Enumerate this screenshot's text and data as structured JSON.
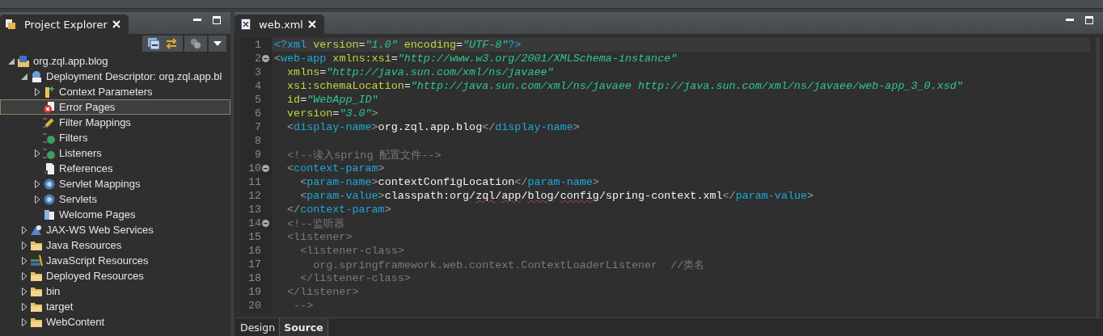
{
  "explorer": {
    "title": "Project Explorer",
    "tree": [
      {
        "label": "org.zql.app.blog",
        "kind": "project",
        "expanded": true,
        "selected": false,
        "children": [
          {
            "label": "Deployment Descriptor: org.zql.app.bl",
            "kind": "descriptor",
            "expanded": true,
            "selected": false,
            "children": [
              {
                "label": "Context Parameters",
                "kind": "params",
                "expanded": false,
                "selected": false
              },
              {
                "label": "Error Pages",
                "kind": "error",
                "selected": true
              },
              {
                "label": "Filter Mappings",
                "kind": "mapping",
                "selected": false
              },
              {
                "label": "Filters",
                "kind": "class",
                "selected": false
              },
              {
                "label": "Listeners",
                "kind": "listener",
                "expanded": false,
                "selected": false
              },
              {
                "label": "References",
                "kind": "reference",
                "selected": false
              },
              {
                "label": "Servlet Mappings",
                "kind": "servlet",
                "expanded": false,
                "selected": false
              },
              {
                "label": "Servlets",
                "kind": "servlet",
                "expanded": false,
                "selected": false
              },
              {
                "label": "Welcome Pages",
                "kind": "welcome",
                "selected": false
              }
            ]
          },
          {
            "label": "JAX-WS Web Services",
            "kind": "service",
            "expanded": false,
            "selected": false
          },
          {
            "label": "Java Resources",
            "kind": "java",
            "expanded": false,
            "selected": false
          },
          {
            "label": "JavaScript Resources",
            "kind": "script",
            "expanded": false,
            "selected": false
          },
          {
            "label": "Deployed Resources",
            "kind": "deployed",
            "expanded": false,
            "selected": false
          },
          {
            "label": "bin",
            "kind": "folder",
            "expanded": false,
            "selected": false
          },
          {
            "label": "target",
            "kind": "folder",
            "expanded": false,
            "selected": false
          },
          {
            "label": "WebContent",
            "kind": "folder",
            "expanded": false,
            "selected": false
          }
        ]
      }
    ]
  },
  "editor": {
    "tab": "web.xml",
    "lines": [
      {
        "n": "1",
        "fold": false,
        "current": true,
        "tokens": [
          {
            "kind": "tag",
            "text": "<?xml "
          },
          {
            "kind": "attr",
            "text": "version"
          },
          {
            "kind": "plain",
            "text": "="
          },
          {
            "kind": "value",
            "text": "\"1.0\" "
          },
          {
            "kind": "attr",
            "text": "encoding"
          },
          {
            "kind": "plain",
            "text": "="
          },
          {
            "kind": "value",
            "text": "\"UTF-8\""
          },
          {
            "kind": "tag",
            "text": "?>"
          }
        ]
      },
      {
        "n": "2",
        "fold": true,
        "current": false,
        "tokens": [
          {
            "kind": "punct",
            "text": "<"
          },
          {
            "kind": "tag",
            "text": "web-app "
          },
          {
            "kind": "attr",
            "text": "xmlns:xsi"
          },
          {
            "kind": "plain",
            "text": "="
          },
          {
            "kind": "value",
            "text": "\"http://www.w3.org/2001/XMLSchema-instance\""
          }
        ]
      },
      {
        "n": "3",
        "fold": false,
        "current": false,
        "tokens": [
          {
            "kind": "attr",
            "text": "  xmlns"
          },
          {
            "kind": "plain",
            "text": "="
          },
          {
            "kind": "value",
            "text": "\"http://java.sun.com/xml/ns/javaee\""
          }
        ]
      },
      {
        "n": "4",
        "fold": false,
        "current": false,
        "tokens": [
          {
            "kind": "attr",
            "text": "  xsi:schemaLocation"
          },
          {
            "kind": "plain",
            "text": "="
          },
          {
            "kind": "value",
            "text": "\"http://java.sun.com/xml/ns/javaee http://java.sun.com/xml/ns/javaee/web-app_3_0.xsd\""
          }
        ]
      },
      {
        "n": "5",
        "fold": false,
        "current": false,
        "tokens": [
          {
            "kind": "attr",
            "text": "  id"
          },
          {
            "kind": "plain",
            "text": "="
          },
          {
            "kind": "value",
            "text": "\"WebApp_ID\""
          }
        ]
      },
      {
        "n": "6",
        "fold": false,
        "current": false,
        "tokens": [
          {
            "kind": "attr",
            "text": "  version"
          },
          {
            "kind": "plain",
            "text": "="
          },
          {
            "kind": "value",
            "text": "\"3.0\""
          },
          {
            "kind": "punct",
            "text": ">"
          }
        ]
      },
      {
        "n": "7",
        "fold": false,
        "current": false,
        "tokens": [
          {
            "kind": "punct",
            "text": "  <"
          },
          {
            "kind": "tag",
            "text": "display-name"
          },
          {
            "kind": "punct",
            "text": ">"
          },
          {
            "kind": "plain",
            "text": "org.zql.app.blog"
          },
          {
            "kind": "punct",
            "text": "</"
          },
          {
            "kind": "tag",
            "text": "display-name"
          },
          {
            "kind": "punct",
            "text": ">"
          }
        ]
      },
      {
        "n": "8",
        "fold": false,
        "current": false
      },
      {
        "n": "9",
        "fold": false,
        "current": false,
        "tokens": [
          {
            "kind": "comment",
            "text": "  <!--读入spring 配置文件-->"
          }
        ]
      },
      {
        "n": "10",
        "fold": true,
        "current": false,
        "tokens": [
          {
            "kind": "punct",
            "text": "  <"
          },
          {
            "kind": "tag",
            "text": "context-param"
          },
          {
            "kind": "punct",
            "text": ">"
          }
        ]
      },
      {
        "n": "11",
        "fold": false,
        "current": false,
        "tokens": [
          {
            "kind": "punct",
            "text": "    <"
          },
          {
            "kind": "tag",
            "text": "param-name"
          },
          {
            "kind": "punct",
            "text": ">"
          },
          {
            "kind": "plain",
            "text": "contextConfigLocation"
          },
          {
            "kind": "punct",
            "text": "</"
          },
          {
            "kind": "tag",
            "text": "param-name"
          },
          {
            "kind": "punct",
            "text": ">"
          }
        ]
      },
      {
        "n": "12",
        "fold": false,
        "current": false,
        "tokens": [
          {
            "kind": "punct",
            "text": "    <"
          },
          {
            "kind": "tag",
            "text": "param-value"
          },
          {
            "kind": "punct",
            "text": ">"
          },
          {
            "kind": "plain",
            "text": "classpath:org/"
          },
          {
            "kind": "misspelled",
            "text": "zql"
          },
          {
            "kind": "plain",
            "text": "/"
          },
          {
            "kind": "misspelled",
            "text": "app"
          },
          {
            "kind": "plain",
            "text": "/"
          },
          {
            "kind": "misspelled",
            "text": "blog"
          },
          {
            "kind": "plain",
            "text": "/"
          },
          {
            "kind": "misspelled",
            "text": "config"
          },
          {
            "kind": "plain",
            "text": "/spring-context.xml"
          },
          {
            "kind": "punct",
            "text": "</"
          },
          {
            "kind": "tag",
            "text": "param-value"
          },
          {
            "kind": "punct",
            "text": ">"
          }
        ]
      },
      {
        "n": "13",
        "fold": false,
        "current": false,
        "tokens": [
          {
            "kind": "punct",
            "text": "  </"
          },
          {
            "kind": "tag",
            "text": "context-param"
          },
          {
            "kind": "punct",
            "text": ">"
          }
        ]
      },
      {
        "n": "14",
        "fold": true,
        "current": false,
        "tokens": [
          {
            "kind": "comment",
            "text": "  <!--监听器"
          }
        ]
      },
      {
        "n": "15",
        "fold": false,
        "current": false,
        "tokens": [
          {
            "kind": "comment",
            "text": "  <listener>"
          }
        ]
      },
      {
        "n": "16",
        "fold": false,
        "current": false,
        "tokens": [
          {
            "kind": "comment",
            "text": "    <listener-class>"
          }
        ]
      },
      {
        "n": "17",
        "fold": false,
        "current": false,
        "tokens": [
          {
            "kind": "comment",
            "text": "      org.springframework.web.context.ContextLoaderListener  //类名"
          }
        ]
      },
      {
        "n": "18",
        "fold": false,
        "current": false,
        "tokens": [
          {
            "kind": "comment",
            "text": "    </listener-class>"
          }
        ]
      },
      {
        "n": "19",
        "fold": false,
        "current": false,
        "tokens": [
          {
            "kind": "comment",
            "text": "  </listener>"
          }
        ]
      },
      {
        "n": "20",
        "fold": false,
        "current": false,
        "tokens": [
          {
            "kind": "comment",
            "text": "   -->"
          }
        ]
      }
    ],
    "views": [
      {
        "label": "Design",
        "selected": false
      },
      {
        "label": "Source",
        "selected": true
      }
    ]
  }
}
